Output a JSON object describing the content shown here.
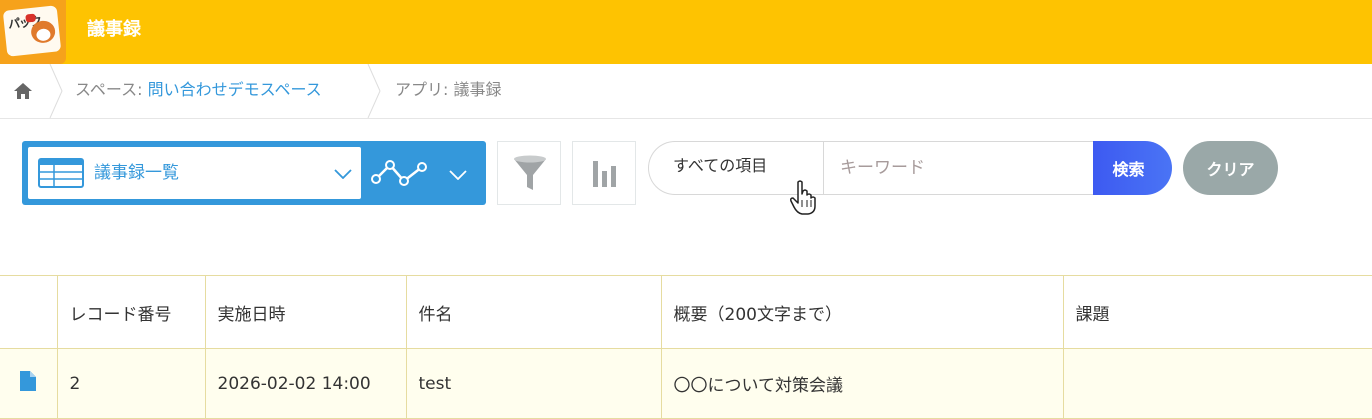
{
  "header": {
    "app_title": "議事録",
    "app_icon_text": "パック"
  },
  "breadcrumb": {
    "home_icon": "home-icon",
    "space_prefix": "スペース: ",
    "space_name": "問い合わせデモスペース",
    "app_label": "アプリ: 議事録"
  },
  "toolbar": {
    "view_name": "議事録一覧",
    "filter_icon": "funnel-icon",
    "chart_icon": "bar-chart-icon",
    "search_scope": "すべての項目",
    "search_placeholder": "キーワード",
    "search_label": "検索",
    "clear_label": "クリア"
  },
  "table": {
    "columns": [
      "",
      "レコード番号",
      "実施日時",
      "件名",
      "概要（200文字まで）",
      "課題"
    ],
    "rows": [
      {
        "icon": "document-icon",
        "record_number": "2",
        "datetime": "2026-02-02 14:00",
        "subject": "test",
        "summary": "〇〇について対策会議",
        "issue": ""
      }
    ]
  },
  "colors": {
    "header_bg": "#fec301",
    "accent_blue": "#3498db",
    "search_button": "#3d5af1",
    "clear_button": "#9aa8a8",
    "row_bg": "#fffeee",
    "grid_line": "#e6dca0"
  }
}
